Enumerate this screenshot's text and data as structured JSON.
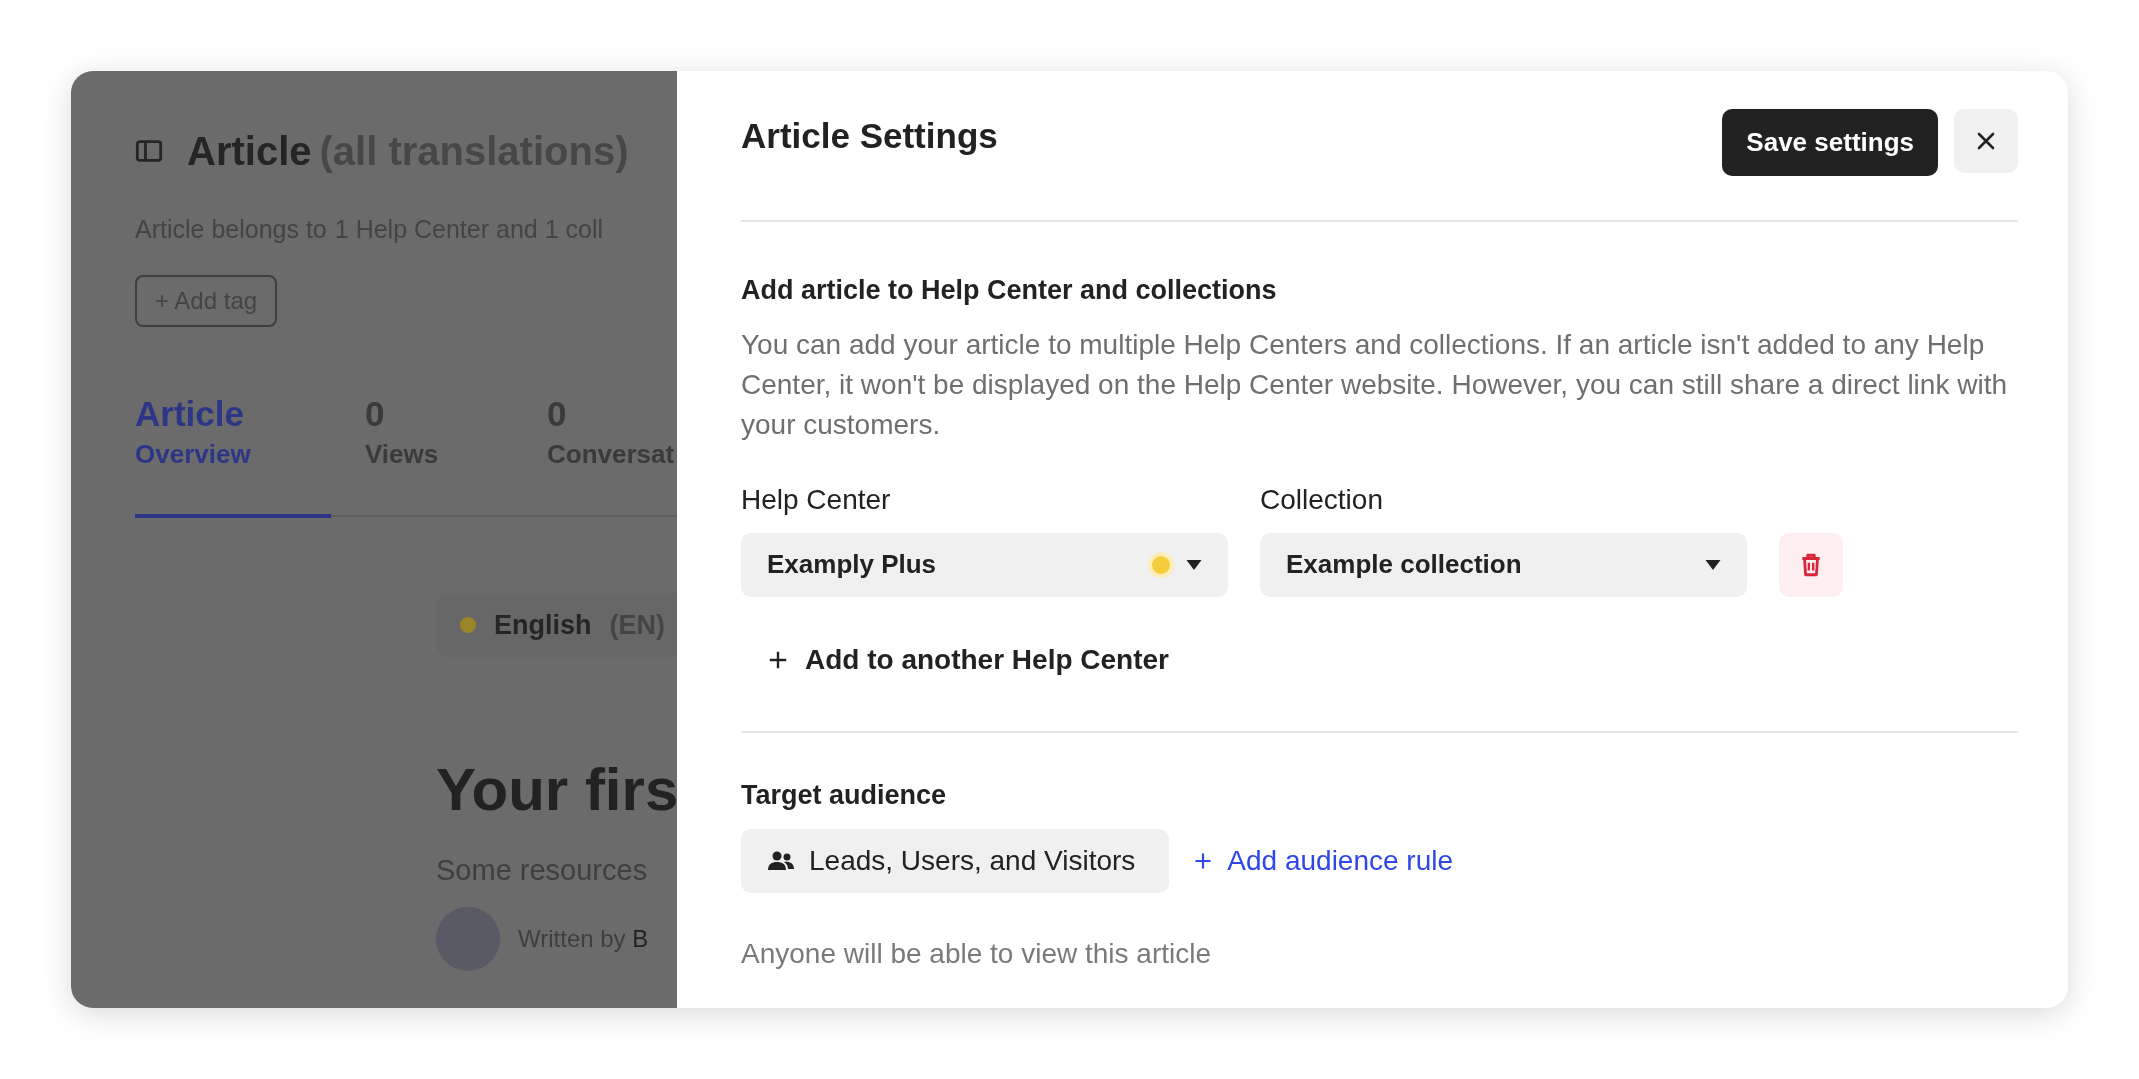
{
  "background_page": {
    "title": "Article",
    "title_suffix": "(all translations)",
    "belongs_text": "Article belongs to",
    "belongs_link": "1 Help Center and 1 coll",
    "add_tag": "+ Add tag",
    "tabs": [
      {
        "value": "Article",
        "label": "Overview",
        "selected": true
      },
      {
        "value": "0",
        "label": "Views",
        "selected": false
      },
      {
        "value": "0",
        "label": "Conversat",
        "selected": false
      }
    ],
    "language": {
      "name": "English",
      "code": "(EN)"
    },
    "heading": "Your firs",
    "subtitle": "Some resources",
    "author_prefix": "Written by",
    "author_name": "B"
  },
  "settings_panel": {
    "title": "Article Settings",
    "save_button": "Save settings",
    "help_center_section": {
      "heading": "Add article to Help Center and collections",
      "description": "You can add your article to multiple Help Centers and collections. If an article isn't added to any Help Center, it won't be displayed on the Help Center website. However, you can still share a direct link with your customers.",
      "help_center": {
        "label": "Help Center",
        "value": "Examply Plus"
      },
      "collection": {
        "label": "Collection",
        "value": "Example collection"
      },
      "add_button": "Add to another Help Center"
    },
    "audience_section": {
      "heading": "Target audience",
      "audience": "Leads, Users, and Visitors",
      "add_rule": "Add audience rule",
      "note": "Anyone will be able to view this article"
    }
  }
}
